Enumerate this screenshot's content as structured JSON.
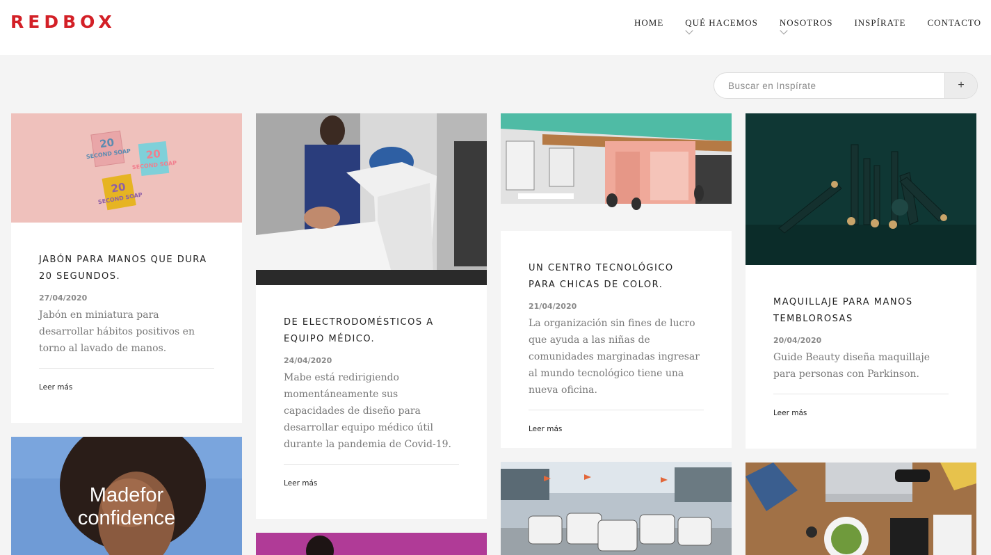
{
  "header": {
    "logo": "REDBOX",
    "nav": [
      {
        "label": "HOME",
        "has_dropdown": false
      },
      {
        "label": "QUÉ HACEMOS",
        "has_dropdown": true
      },
      {
        "label": "NOSOTROS",
        "has_dropdown": true
      },
      {
        "label": "INSPÍRATE",
        "has_dropdown": false
      },
      {
        "label": "CONTACTO",
        "has_dropdown": false
      }
    ]
  },
  "search": {
    "placeholder": "Buscar en Inspírate",
    "button": "+"
  },
  "cards": [
    {
      "title": "JABÓN PARA MANOS QUE DURA 20 SEGUNDOS.",
      "date": "27/04/2020",
      "excerpt": "Jabón en miniatura para desarrollar hábitos positivos en torno al lavado de manos.",
      "more": "Leer más"
    },
    {
      "title": "DE ELECTRODOMÉSTICOS A EQUIPO MÉDICO.",
      "date": "24/04/2020",
      "excerpt": "Mabe está redirigiendo momentáneamente sus capacidades de diseño para desarrollar equipo médico útil durante la pandemia de Covid-19.",
      "more": "Leer más"
    },
    {
      "title": "UN CENTRO TECNOLÓGICO PARA CHICAS DE COLOR.",
      "date": "21/04/2020",
      "excerpt": "La organización sin fines de lucro que ayuda a las niñas de comunidades marginadas ingresar al mundo tecnológico tiene una nueva oficina.",
      "more": "Leer más"
    },
    {
      "title": "MAQUILLAJE PARA MANOS TEMBLOROSAS",
      "date": "20/04/2020",
      "excerpt": "Guide Beauty diseña maquillaje para personas con Parkinson.",
      "more": "Leer más"
    }
  ],
  "soap_labels": [
    "20 SECOND SOAP",
    "20 SECOND SOAP",
    "20 SECOND SOAP"
  ],
  "confidence_card": {
    "line1": "Madefor",
    "line2": "confidence"
  },
  "colors": {
    "brand": "#d32027",
    "background": "#f4f4f4"
  }
}
